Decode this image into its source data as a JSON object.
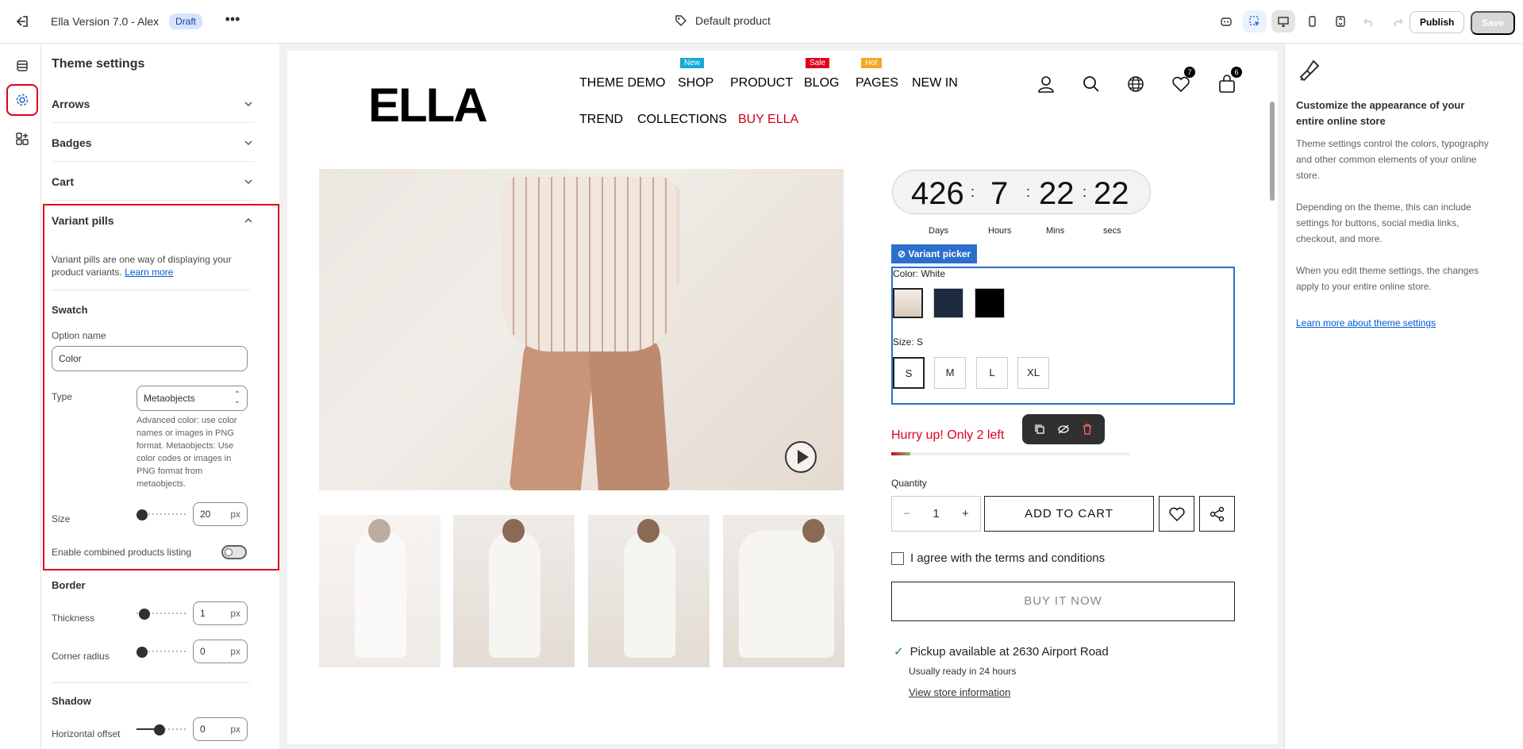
{
  "topbar": {
    "title": "Ella Version 7.0 - Alex",
    "badge": "Draft",
    "template": "Default product",
    "publish": "Publish",
    "save": "Save"
  },
  "settings": {
    "heading": "Theme settings",
    "sections": [
      {
        "label": "Arrows"
      },
      {
        "label": "Badges"
      },
      {
        "label": "Cart"
      },
      {
        "label": "Variant pills"
      }
    ],
    "variant_pills": {
      "description": "Variant pills are one way of displaying your product variants.",
      "learn_more": "Learn more",
      "swatch_heading": "Swatch",
      "option_name_label": "Option name",
      "option_name_value": "Color",
      "type_label": "Type",
      "type_value": "Metaobjects",
      "type_help": "Advanced color: use color names or images in PNG format. Metaobjects: Use color codes or images in PNG format from metaobjects.",
      "size_label": "Size",
      "size_value": "20",
      "size_unit": "px",
      "combined_label": "Enable combined products listing",
      "combined_enabled": false
    },
    "border": {
      "heading": "Border",
      "thickness_label": "Thickness",
      "thickness_value": "1",
      "corner_label": "Corner radius",
      "corner_value": "0",
      "unit": "px"
    },
    "shadow": {
      "heading": "Shadow",
      "hoffset_label": "Horizontal offset",
      "hoffset_value": "0",
      "unit": "px"
    }
  },
  "store": {
    "logo": "ELLA",
    "nav": [
      {
        "label": "THEME DEMO"
      },
      {
        "label": "SHOP",
        "badge": "New",
        "badge_color": "#14a9d6"
      },
      {
        "label": "PRODUCT"
      },
      {
        "label": "BLOG",
        "badge": "Sale",
        "badge_color": "#e0001b"
      },
      {
        "label": "PAGES",
        "badge": "Hot",
        "badge_color": "#f5a623"
      },
      {
        "label": "NEW IN"
      },
      {
        "label": "TREND"
      },
      {
        "label": "COLLECTIONS"
      },
      {
        "label": "BUY ELLA"
      }
    ],
    "wishlist_count": "7",
    "cart_count": "6",
    "countdown": {
      "days": "426",
      "hours": "7",
      "mins": "22",
      "secs": "22",
      "days_label": "Days",
      "hours_label": "Hours",
      "mins_label": "Mins",
      "secs_label": "secs"
    },
    "variant_picker": {
      "tag": "Variant picker",
      "color_label": "Color: White",
      "size_label": "Size: S",
      "swatches": [
        "#e9e1d7",
        "#1e2a3d",
        "#000000"
      ],
      "sizes": [
        "S",
        "M",
        "L",
        "XL"
      ]
    },
    "hurry": "Hurry up! Only 2 left",
    "stock_fraction": 0.08,
    "quantity_label": "Quantity",
    "quantity_value": "1",
    "add_to_cart": "ADD TO CART",
    "agree": "I agree with the terms and conditions",
    "buy_now": "BUY IT NOW",
    "pickup": "Pickup available at 2630 Airport Road",
    "ready": "Usually ready in 24 hours",
    "view_store": "View store information"
  },
  "right": {
    "title": "Customize the appearance of your entire online store",
    "p1": "Theme settings control the colors, typography and other common elements of your online store.",
    "p2": "Depending on the theme, this can include settings for buttons, social media links, checkout, and more.",
    "p3": "When you edit theme settings, the changes apply to your entire online store.",
    "link": "Learn more about theme settings"
  }
}
